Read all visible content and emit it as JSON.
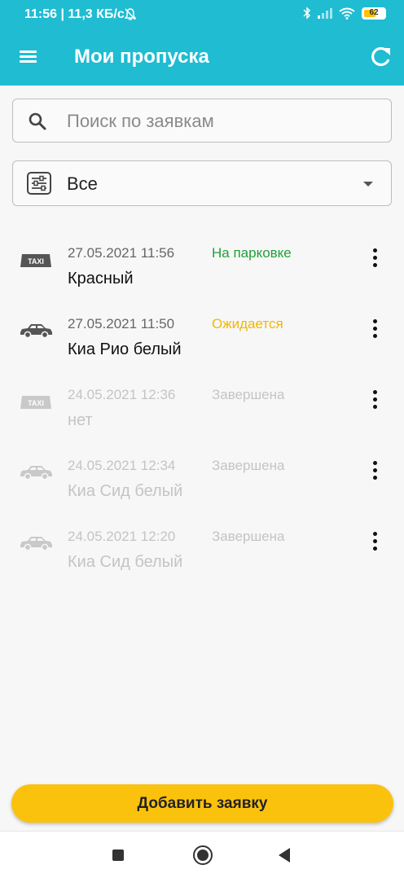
{
  "status_bar": {
    "time_and_speed": "11:56 | 11,3 КБ/с",
    "battery": "62",
    "battery_level": 0.62
  },
  "app_bar": {
    "title": "Мои пропуска"
  },
  "search": {
    "placeholder": "Поиск по заявкам",
    "value": ""
  },
  "filter": {
    "selected": "Все"
  },
  "requests": [
    {
      "date": "27.05.2021 11:56",
      "status": "На парковке",
      "status_color": "#21a038",
      "name": "Красный",
      "icon": "taxi-icon",
      "faded": false
    },
    {
      "date": "27.05.2021 11:50",
      "status": "Ожидается",
      "status_color": "#f2b705",
      "name": "Киа Рио белый",
      "icon": "car-icon",
      "faded": false
    },
    {
      "date": "24.05.2021 12:36",
      "status": "Завершена",
      "status_color": "#c4c4c4",
      "name": "нет",
      "icon": "taxi-icon",
      "faded": true
    },
    {
      "date": "24.05.2021 12:34",
      "status": "Завершена",
      "status_color": "#c4c4c4",
      "name": "Киа Сид белый",
      "icon": "car-icon",
      "faded": true
    },
    {
      "date": "24.05.2021 12:20",
      "status": "Завершена",
      "status_color": "#c4c4c4",
      "name": "Киа Сид белый",
      "icon": "car-icon",
      "faded": true
    }
  ],
  "actions": {
    "add_request": "Добавить заявку"
  },
  "colors": {
    "primary": "#1fbcd2",
    "accent": "#fbc20d"
  },
  "icons": {
    "taxi_label": "TAXI"
  }
}
